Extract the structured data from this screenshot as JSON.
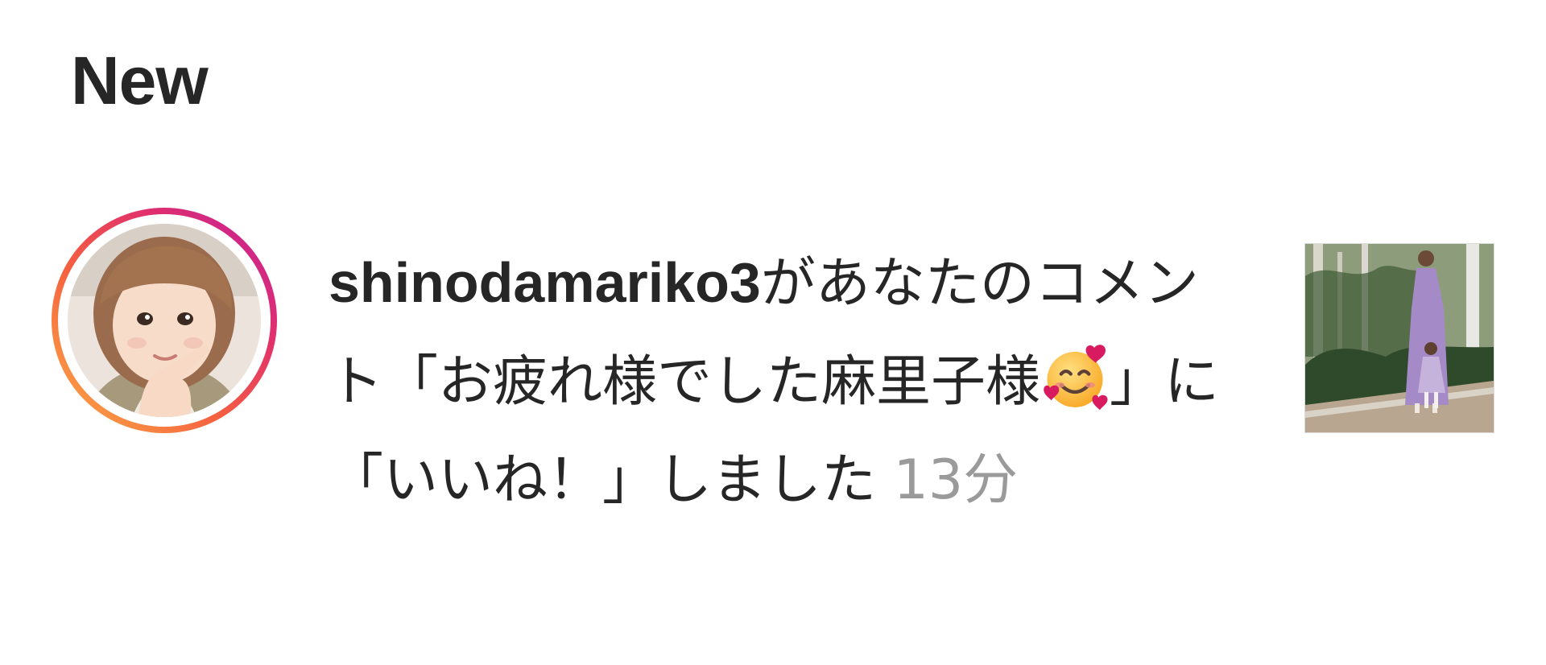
{
  "section": {
    "title": "New"
  },
  "notification": {
    "username": "shinodamariko3",
    "text_part1": "があなたのコメント「お疲れ様でした麻里子様",
    "emoji": "smiling-face-with-hearts-emoji",
    "text_part2": "」に「いいね！」しました",
    "time": "13分"
  },
  "colors": {
    "text": "#262626",
    "timestamp": "#9a9a9a",
    "ring_start": "#c01fa0",
    "ring_end": "#fcaf45"
  }
}
